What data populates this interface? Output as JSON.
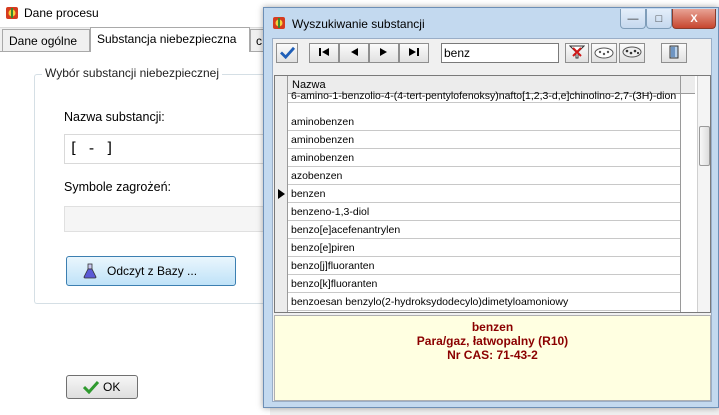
{
  "main_window": {
    "title": "Dane procesu",
    "tabs": [
      "Dane ogólne",
      "Substancja niebezpieczna",
      "c"
    ],
    "group_title": "Wybór substancji niebezpiecznej",
    "substance_name_label": "Nazwa substancji:",
    "substance_name_value": "[ - ]",
    "hazard_symbols_label": "Symbole zagrożeń:",
    "read_button_label": "Odczyt z Bazy ...",
    "ok_button_label": "OK"
  },
  "dialog": {
    "title": "Wyszukiwanie substancji",
    "window_buttons": {
      "minimize": "—",
      "maximize": "□",
      "close": "X"
    },
    "search_value": "benz",
    "column_header": "Nazwa",
    "rows": [
      "6-amino-1-benzolio-4-(4-tert-pentylofenoksy)nafto[1,2,3-d,e]chinolino-2,7-(3H)-dion",
      "aminobenzen",
      "aminobenzen",
      "aminobenzen",
      "azobenzen",
      "benzen",
      "benzeno-1,3-diol",
      "benzo[e]acefenantrylen",
      "benzo[e]piren",
      "benzo[j]fluoranten",
      "benzo[k]fluoranten",
      "benzoesan benzylo(2-hydroksydodecylo)dimetyloamoniowy"
    ],
    "selected_index": 5,
    "info": {
      "name": "benzen",
      "hazard": "Para/gaz, łatwopalny (R10)",
      "cas": "Nr CAS: 71-43-2"
    }
  },
  "colors": {
    "info_text": "#8b0000",
    "info_background": "#ffffe1",
    "dialog_frame": "#c3d9ef"
  }
}
